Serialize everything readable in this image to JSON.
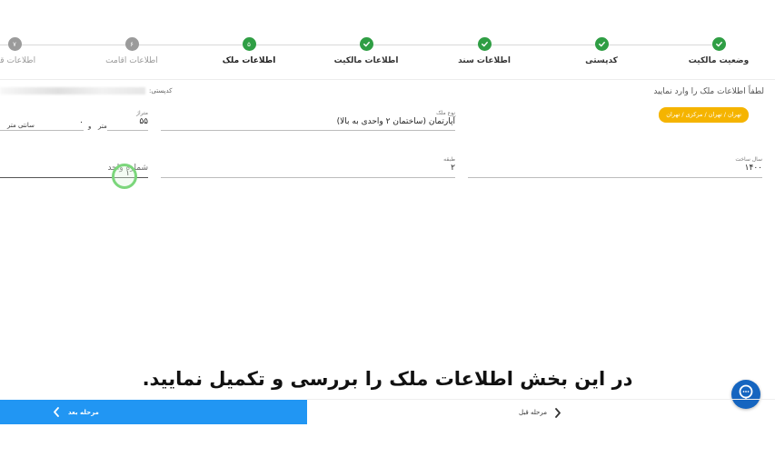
{
  "stepper": {
    "steps": [
      {
        "label": "وضعیت مالکیت",
        "number": "",
        "status": "done"
      },
      {
        "label": "کدپستی",
        "number": "",
        "status": "done"
      },
      {
        "label": "اطلاعات سند",
        "number": "",
        "status": "done"
      },
      {
        "label": "اطلاعات مالکیت",
        "number": "",
        "status": "done"
      },
      {
        "label": "اطلاعات ملک",
        "number": "۵",
        "status": "current"
      },
      {
        "label": "اطلاعات اقامت",
        "number": "۶",
        "status": "pending"
      },
      {
        "label": "اطلاعات قبو",
        "number": "۷",
        "status": "pending"
      }
    ]
  },
  "form": {
    "hint": "لطفاً اطلاعات ملک را وارد نمایید",
    "location_chip": "تهران / تهران / مرکزی / تهران",
    "postal_label": "کدپستی:",
    "property_type": {
      "label": "نوع ملک",
      "value": "آپارتمان (ساختمان ۲ واحدی به بالا)"
    },
    "area": {
      "label": "متراژ",
      "value": "۵۵",
      "unit_meter": "متر",
      "and": "و",
      "centimeter_value": "۰",
      "unit_cm": "سانتی متر"
    },
    "build_year": {
      "label": "سال ساخت",
      "value": "۱۴۰۰"
    },
    "floor": {
      "label": "طبقه",
      "value": "۲"
    },
    "unit_number": {
      "label": "شماره واحد",
      "value": "۱"
    }
  },
  "caption": "در این بخش اطلاعات ملک را بررسی و تکمیل نمایید.",
  "footer": {
    "next_label": "مرحله بعد",
    "prev_label": "مرحله قبل"
  },
  "colors": {
    "done": "#2f9e44",
    "pending": "#9b9b9b",
    "chip": "#f5b400",
    "primary": "#2196f3",
    "chat": "#1565c0"
  },
  "icons": {
    "done_step": "check-icon",
    "next": "chevron-left-icon",
    "prev": "chevron-right-icon",
    "chat": "chat-bubble-icon"
  }
}
